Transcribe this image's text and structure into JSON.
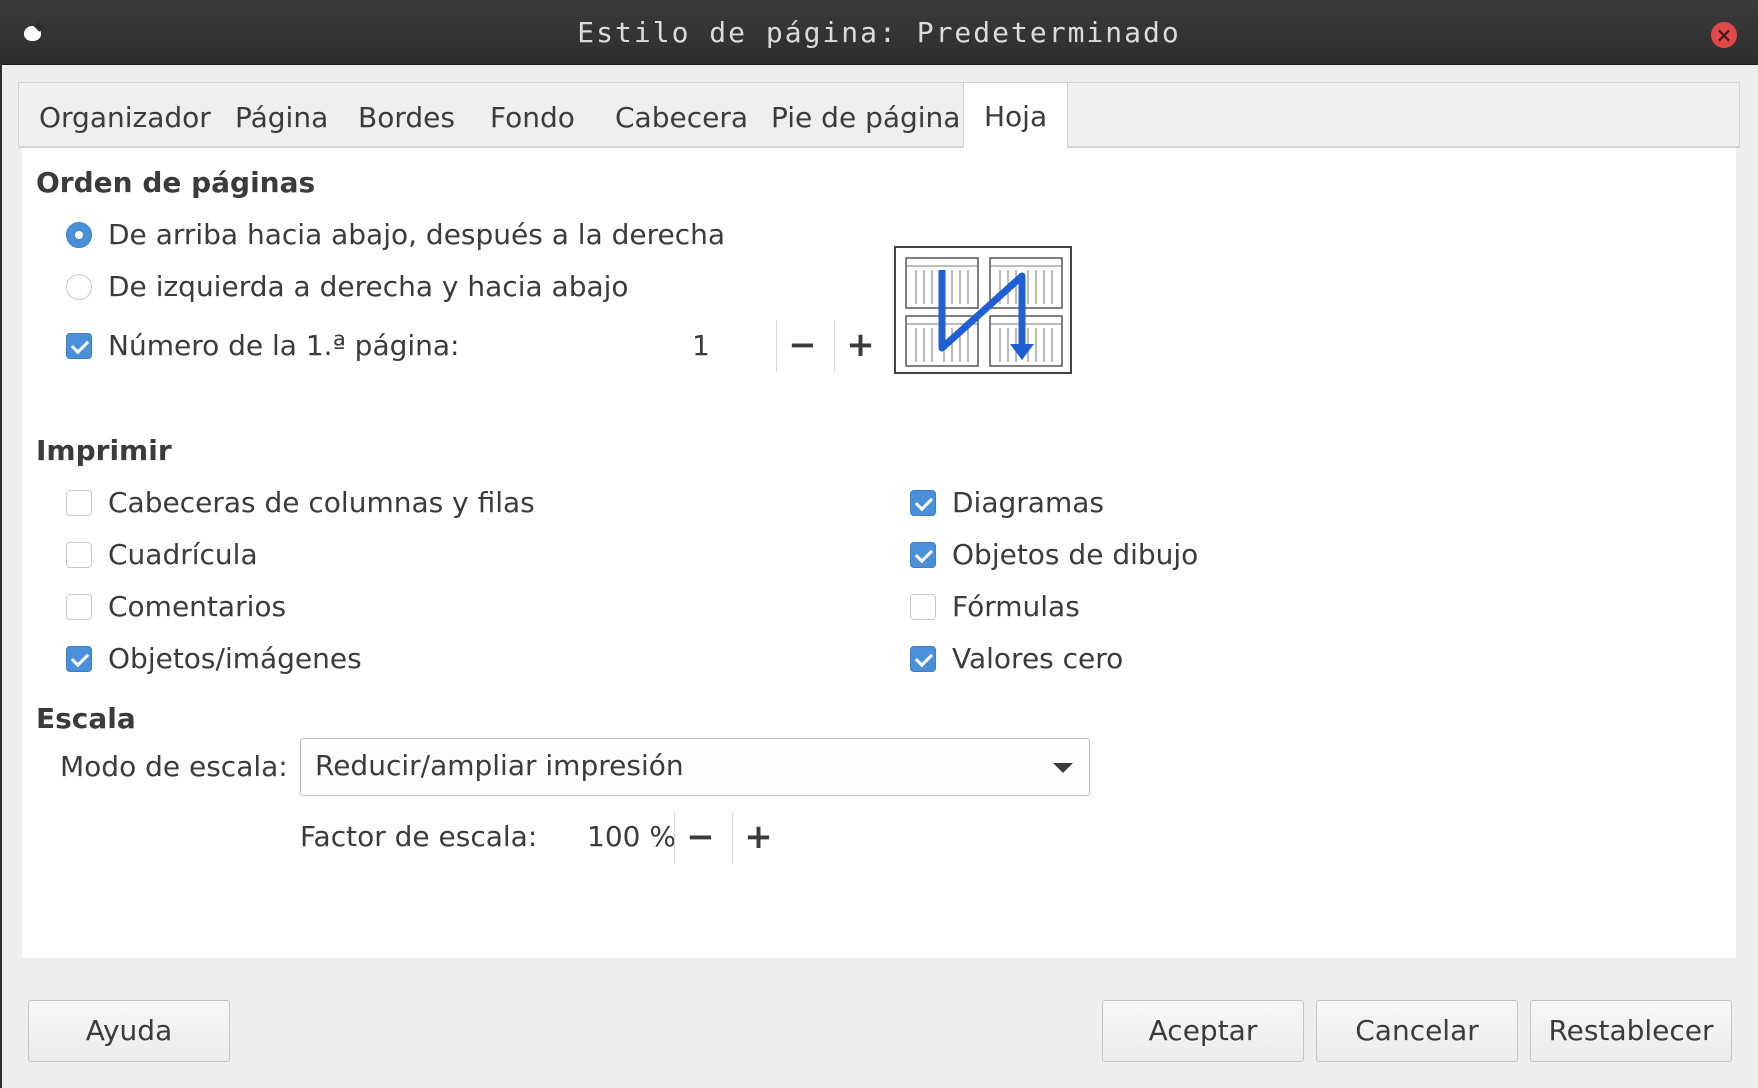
{
  "window": {
    "title": "Estilo de página: Predeterminado"
  },
  "tabs": [
    {
      "label": "Organizador",
      "active": false
    },
    {
      "label": "Página",
      "active": false
    },
    {
      "label": "Bordes",
      "active": false
    },
    {
      "label": "Fondo",
      "active": false
    },
    {
      "label": "Cabecera",
      "active": false
    },
    {
      "label": "Pie de página",
      "active": false
    },
    {
      "label": "Hoja",
      "active": true
    }
  ],
  "page_order": {
    "heading": "Orden de páginas",
    "option_top_bottom": {
      "label": "De arriba hacia abajo, después a la derecha",
      "selected": true
    },
    "option_left_right": {
      "label": "De izquierda a derecha y hacia abajo",
      "selected": false
    },
    "first_page_number": {
      "label": "Número de la 1.ª página:",
      "checked": true,
      "value": "1"
    },
    "decrement_symbol": "−",
    "increment_symbol": "+"
  },
  "print": {
    "heading": "Imprimir",
    "options": [
      {
        "label": "Cabeceras de columnas y filas",
        "checked": false
      },
      {
        "label": "Cuadrícula",
        "checked": false
      },
      {
        "label": "Comentarios",
        "checked": false
      },
      {
        "label": "Objetos/imágenes",
        "checked": true
      },
      {
        "label": "Diagramas",
        "checked": true
      },
      {
        "label": "Objetos de dibujo",
        "checked": true
      },
      {
        "label": "Fórmulas",
        "checked": false
      },
      {
        "label": "Valores cero",
        "checked": true
      }
    ]
  },
  "scale": {
    "heading": "Escala",
    "mode_label": "Modo de escala:",
    "mode_value": "Reducir/ampliar impresión",
    "factor_label": "Factor de escala:",
    "factor_value": "100 %",
    "decrement_symbol": "−",
    "increment_symbol": "+"
  },
  "buttons": {
    "help": "Ayuda",
    "ok": "Aceptar",
    "cancel": "Cancelar",
    "reset": "Restablecer"
  },
  "colors": {
    "accent": "#4a90d9",
    "preview_arrow": "#1e5fd6",
    "close_button": "#e24a4a"
  }
}
